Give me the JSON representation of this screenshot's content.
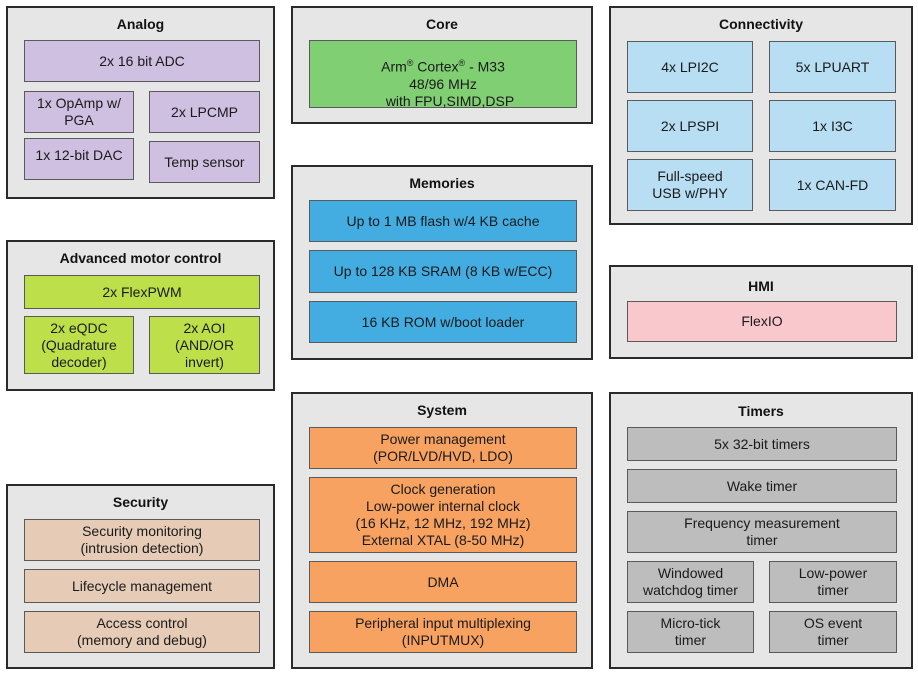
{
  "groups": {
    "analog": {
      "title": "Analog",
      "blocks": [
        "2x 16 bit ADC",
        "1x OpAmp  w/\nPGA",
        "2x LPCMP",
        "1x 12-bit DAC",
        "Temp sensor"
      ]
    },
    "core": {
      "title": "Core",
      "line1_a": "Arm",
      "line1_b": " Cortex",
      "line1_c": " - M33",
      "reg_mark": "®",
      "line2": "48/96 MHz",
      "line3": "with FPU,SIMD,DSP"
    },
    "connectivity": {
      "title": "Connectivity",
      "blocks": [
        "4x LPI2C",
        "5x LPUART",
        "2x LPSPI",
        "1x I3C",
        "Full-speed\nUSB w/PHY",
        "1x CAN-FD"
      ]
    },
    "motor": {
      "title": "Advanced motor control",
      "blocks": [
        "2x FlexPWM",
        "2x eQDC\n(Quadrature\ndecoder)",
        "2x AOI\n(AND/OR\ninvert)"
      ]
    },
    "memories": {
      "title": "Memories",
      "blocks": [
        "Up to 1 MB flash w/4 KB cache",
        "Up to 128 KB SRAM (8 KB w/ECC)",
        "16 KB ROM w/boot loader"
      ]
    },
    "hmi": {
      "title": "HMI",
      "blocks": [
        "FlexIO"
      ]
    },
    "system": {
      "title": "System",
      "blocks": [
        "Power management\n(POR/LVD/HVD, LDO)",
        "Clock generation\nLow-power internal clock\n(16 KHz, 12 MHz, 192 MHz)\nExternal XTAL (8-50 MHz)",
        "DMA",
        "Peripheral input multiplexing\n(INPUTMUX)"
      ]
    },
    "security": {
      "title": "Security",
      "blocks": [
        "Security monitoring\n(intrusion detection)",
        "Lifecycle management",
        "Access control\n(memory and debug)"
      ]
    },
    "timers": {
      "title": "Timers",
      "blocks": [
        "5x 32-bit timers",
        "Wake timer",
        "Frequency measurement\ntimer",
        "Windowed\nwatchdog timer",
        "Low-power\ntimer",
        "Micro-tick\ntimer",
        "OS event\ntimer"
      ]
    }
  },
  "colors": {
    "analog": "#cfbfe0",
    "core": "#80cf72",
    "motor": "#bde04a",
    "connectivity": "#b7def3",
    "memories": "#43ade2",
    "hmi": "#f8c8cc",
    "system": "#f7a261",
    "security": "#e6cbb7",
    "timers": "#bdbdbd"
  }
}
